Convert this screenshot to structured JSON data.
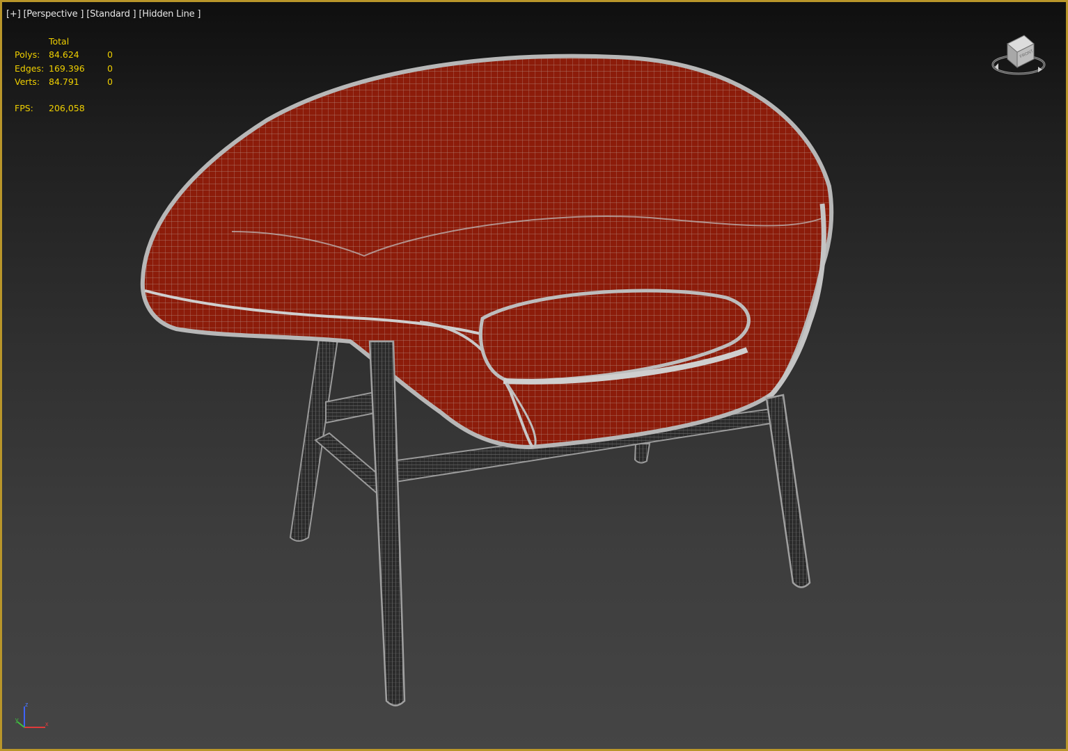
{
  "viewport": {
    "labels": [
      "[+]",
      "[Perspective ]",
      "[Standard ]",
      "[Hidden Line ]"
    ]
  },
  "stats": {
    "header": "Total",
    "rows": [
      {
        "label": "Polys:",
        "total": "84.624",
        "selected": "0"
      },
      {
        "label": "Edges:",
        "total": "169.396",
        "selected": "0"
      },
      {
        "label": "Verts:",
        "total": "84.791",
        "selected": "0"
      }
    ],
    "fps_label": "FPS:",
    "fps_value": "206,058"
  },
  "viewcube": {
    "face_label": "FRONT"
  },
  "axis_tripod": {
    "z": "z",
    "y": "y",
    "x": "x"
  },
  "colors": {
    "border": "#b9962a",
    "stats_text": "#f0d000",
    "shell_fill": "#8c1c0a",
    "wire": "#a9a9a9",
    "leg_fill": "#2a2a2a"
  }
}
